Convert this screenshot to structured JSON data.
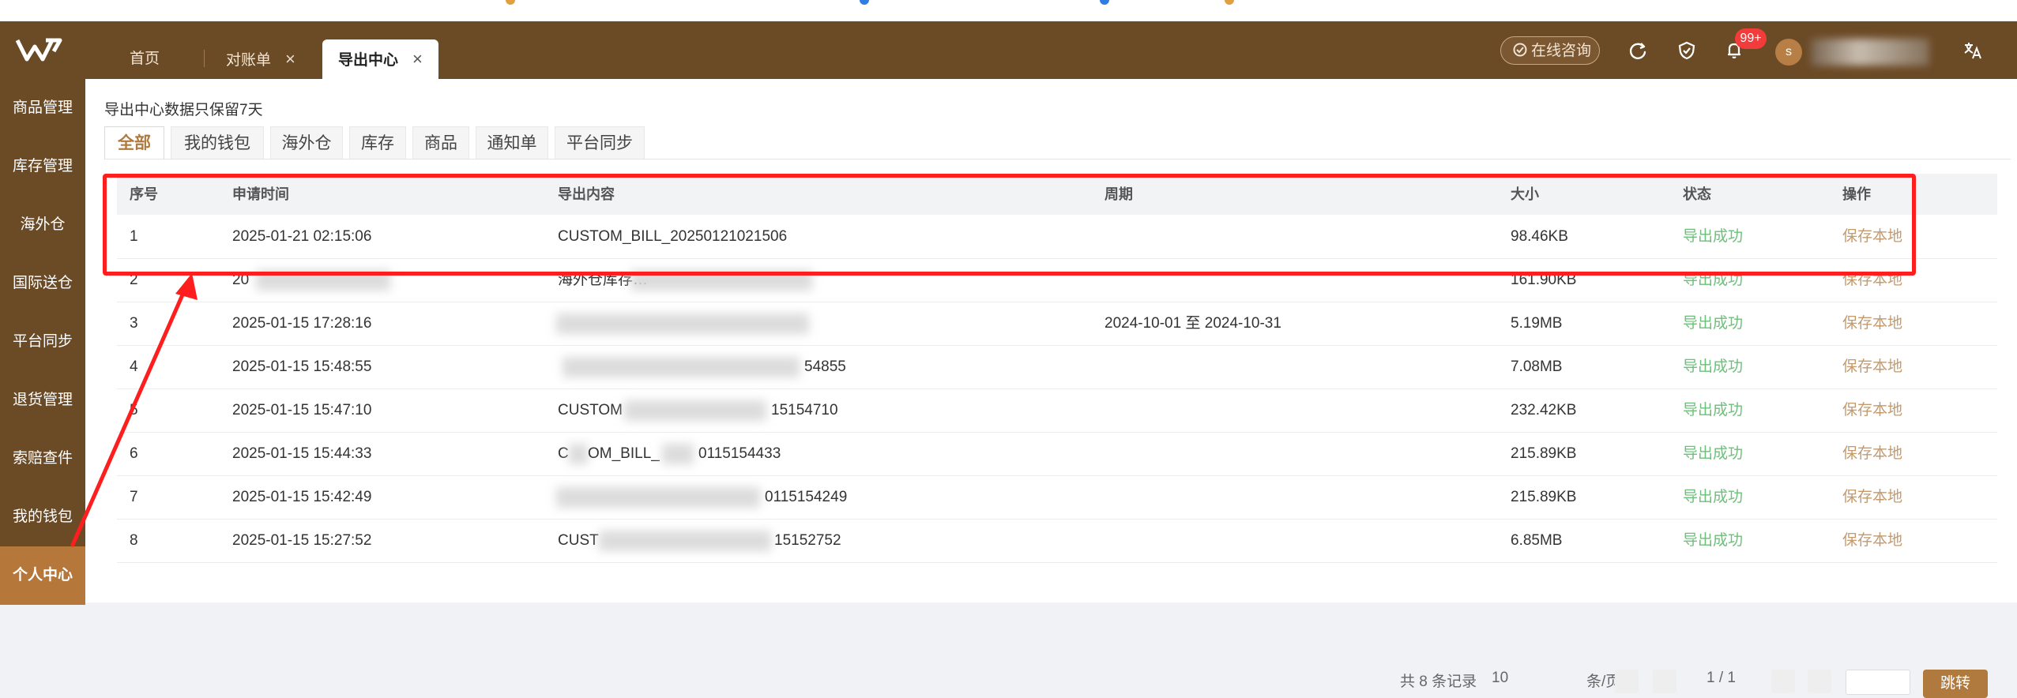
{
  "header": {
    "tabs": [
      {
        "label": "首页",
        "closable": false,
        "active": false
      },
      {
        "label": "对账单",
        "closable": true,
        "active": false
      },
      {
        "label": "导出中心",
        "closable": true,
        "active": true
      }
    ],
    "close_glyph": "×",
    "consult_label": "在线咨询",
    "notification_badge": "99+",
    "avatar_letter": "s",
    "icons": [
      "logo-icon",
      "refresh-icon",
      "shield-icon",
      "bell-icon",
      "translate-icon"
    ]
  },
  "sidebar": {
    "items": [
      {
        "label": "商品管理"
      },
      {
        "label": "库存管理"
      },
      {
        "label": "海外仓"
      },
      {
        "label": "国际送仓"
      },
      {
        "label": "平台同步"
      },
      {
        "label": "退货管理"
      },
      {
        "label": "索赔查件"
      },
      {
        "label": "我的钱包"
      },
      {
        "label": "个人中心",
        "active": true
      }
    ]
  },
  "main": {
    "notice": "导出中心数据只保留7天",
    "filter_tabs": [
      "全部",
      "我的钱包",
      "海外仓",
      "库存",
      "商品",
      "通知单",
      "平台同步"
    ],
    "active_filter": "全部",
    "table": {
      "columns": [
        "序号",
        "申请时间",
        "导出内容",
        "周期",
        "大小",
        "状态",
        "操作"
      ],
      "rows": [
        {
          "no": "1",
          "time": "2025-01-21 02:15:06",
          "content": "CUSTOM_BILL_20250121021506",
          "period": "",
          "size": "98.46KB",
          "status": "导出成功",
          "action": "保存本地"
        },
        {
          "no": "2",
          "time": "20",
          "content": "海外仓库存…",
          "period": "",
          "size": "161.90KB",
          "status": "导出成功",
          "action": "保存本地"
        },
        {
          "no": "3",
          "time": "2025-01-15 17:28:16",
          "content": "",
          "period": "2024-10-01 至 2024-10-31",
          "size": "5.19MB",
          "status": "导出成功",
          "action": "保存本地"
        },
        {
          "no": "4",
          "time": "2025-01-15 15:48:55",
          "content": "54855",
          "period": "",
          "size": "7.08MB",
          "status": "导出成功",
          "action": "保存本地"
        },
        {
          "no": "5",
          "time": "2025-01-15 15:47:10",
          "content": "CUSTOM",
          "content_tail": "15154710",
          "period": "",
          "size": "232.42KB",
          "status": "导出成功",
          "action": "保存本地"
        },
        {
          "no": "6",
          "time": "2025-01-15 15:44:33",
          "content": "C",
          "content_mid": "OM_BILL_",
          "content_tail": "0115154433",
          "period": "",
          "size": "215.89KB",
          "status": "导出成功",
          "action": "保存本地"
        },
        {
          "no": "7",
          "time": "2025-01-15 15:42:49",
          "content": "",
          "content_tail": "0115154249",
          "period": "",
          "size": "215.89KB",
          "status": "导出成功",
          "action": "保存本地"
        },
        {
          "no": "8",
          "time": "2025-01-15 15:27:52",
          "content": "CUST",
          "content_tail": "15152752",
          "period": "",
          "size": "6.85MB",
          "status": "导出成功",
          "action": "保存本地"
        }
      ]
    },
    "pager": {
      "total_text": "共 8 条记录",
      "per_page": "10",
      "per_page_suffix": "条/页",
      "page_text": "1 / 1",
      "jump_label": "跳转"
    }
  },
  "colors": {
    "brand_brown": "#6b4a26",
    "active_sidebar": "#b5773a",
    "success_green": "#6cc07a",
    "action_tan": "#c49a6c",
    "annotation_red": "#ff1e1e",
    "badge_red": "#f23c3c"
  }
}
